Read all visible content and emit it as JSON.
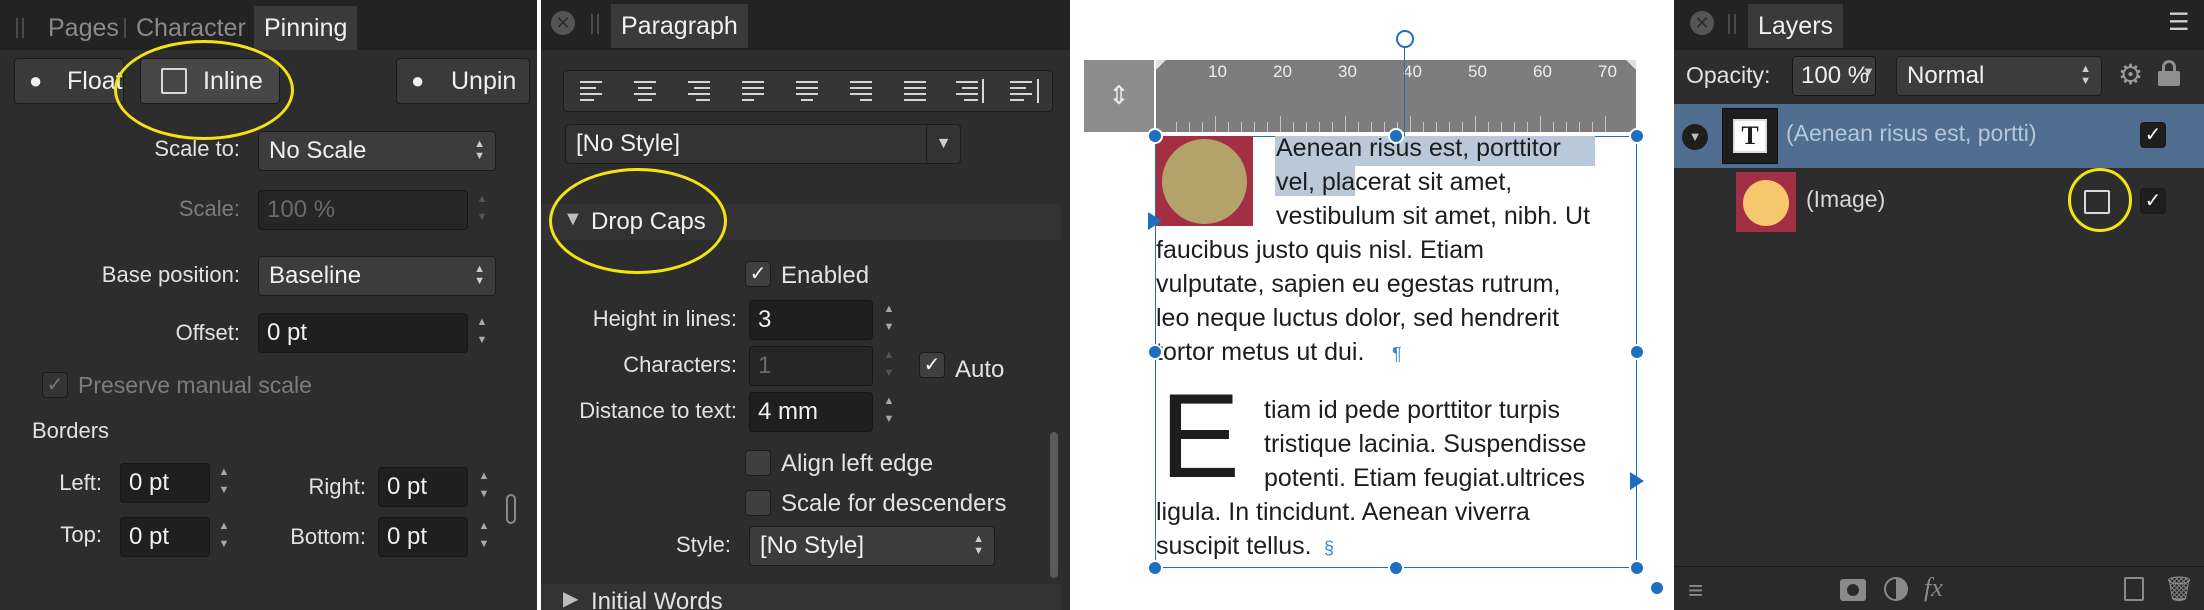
{
  "pinning_panel": {
    "tabs": [
      "Pages",
      "Character",
      "Pinning"
    ],
    "buttons": {
      "float": "Float",
      "inline": "Inline",
      "unpin": "Unpin"
    },
    "scale_to": {
      "label": "Scale to:",
      "value": "No Scale"
    },
    "scale": {
      "label": "Scale:",
      "value": "100 %"
    },
    "base_position": {
      "label": "Base position:",
      "value": "Baseline"
    },
    "offset": {
      "label": "Offset:",
      "value": "0 pt"
    },
    "preserve_manual_scale": "Preserve manual scale",
    "borders": {
      "title": "Borders",
      "left_label": "Left:",
      "left_value": "0 pt",
      "right_label": "Right:",
      "right_value": "0 pt",
      "top_label": "Top:",
      "top_value": "0 pt",
      "bottom_label": "Bottom:",
      "bottom_value": "0 pt"
    }
  },
  "paragraph_panel": {
    "tab": "Paragraph",
    "style_dropdown": "[No Style]",
    "drop_caps": {
      "title": "Drop Caps",
      "enabled_label": "Enabled",
      "height_label": "Height in lines:",
      "height_value": "3",
      "characters_label": "Characters:",
      "characters_value": "1",
      "auto_label": "Auto",
      "distance_label": "Distance to text:",
      "distance_value": "4 mm",
      "align_left_edge": "Align left edge",
      "scale_descenders": "Scale for descenders",
      "style_label": "Style:",
      "style_value": "[No Style]"
    },
    "initial_words": "Initial Words"
  },
  "document": {
    "ruler_ticks": [
      "10",
      "20",
      "30",
      "40",
      "50",
      "60",
      "70"
    ],
    "paragraph1_lines": [
      "Aenean risus est, porttitor",
      "vel, placerat sit amet,",
      "vestibulum sit amet, nibh. Ut",
      "faucibus justo quis nisl. Etiam",
      "vulputate, sapien eu egestas rutrum,",
      "leo neque luctus dolor, sed hendrerit",
      "tortor metus ut dui."
    ],
    "pilcrow": "¶",
    "drop_cap_letter": "E",
    "paragraph2_lines": [
      "tiam id pede porttitor turpis",
      "tristique lacinia. Suspendisse",
      "potenti. Etiam feugiat.ultrices",
      "ligula. In tincidunt. Aenean viverra",
      "suscipit tellus."
    ],
    "end_mark": "§"
  },
  "layers_panel": {
    "tab": "Layers",
    "opacity_label": "Opacity:",
    "opacity_value": "100 %",
    "blend_mode": "Normal",
    "text_layer_name": "(Aenean risus est, portti)",
    "image_layer_name": "(Image)"
  },
  "colors": {
    "panel_bg": "#2d2d2d",
    "annotation_yellow": "#f3e312",
    "selection_blue": "#1f6fc0",
    "layer_selected": "#4f6e90",
    "text_highlight": "#b9c9da",
    "image_frame": "#a32f44",
    "image_circle": "#b3a36a",
    "thumb_circle": "#f6c86e"
  }
}
